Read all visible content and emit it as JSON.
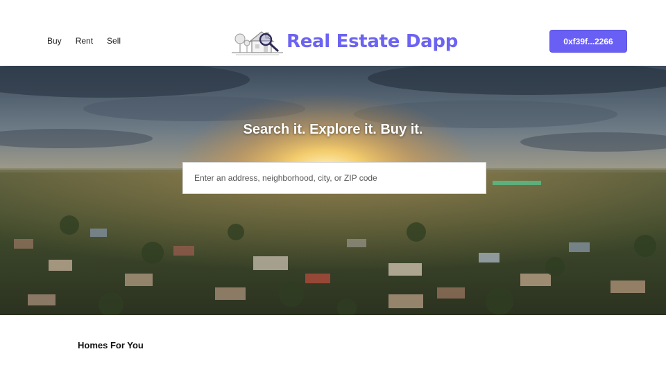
{
  "nav": {
    "links": [
      "Buy",
      "Rent",
      "Sell"
    ],
    "brand_name": "Real Estate Dapp",
    "wallet_label": "0xf39f...2266",
    "brand_logo_icon": "house-magnifier-icon"
  },
  "hero": {
    "title": "Search it. Explore it. Buy it.",
    "search_placeholder": "Enter an address, neighborhood, city, or ZIP code",
    "search_value": ""
  },
  "homes": {
    "title": "Homes For You"
  },
  "colors": {
    "accent": "#6a5ff5",
    "brand_text": "#6c63f2"
  }
}
